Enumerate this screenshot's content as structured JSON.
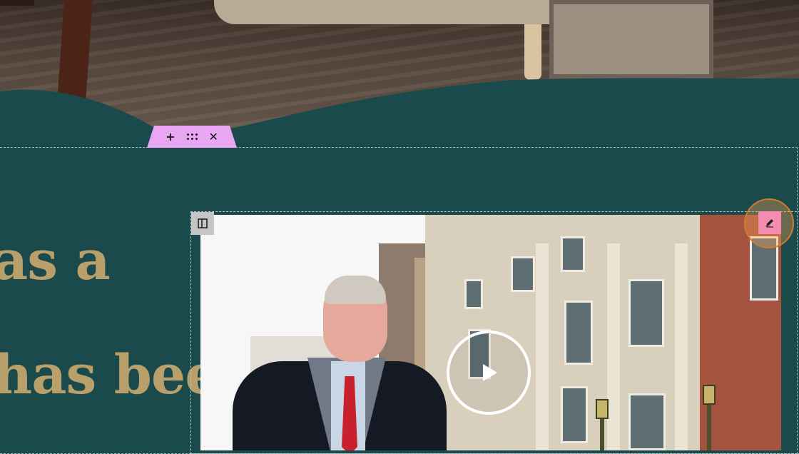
{
  "hero": {
    "background_image": "wooden-floor-with-chair-and-table-photo"
  },
  "block_toolbar": {
    "add_icon": "plus-icon",
    "drag_icon": "drag-handle-icon",
    "close_icon": "close-icon",
    "add_label": "+",
    "close_label": "✕",
    "accent_color": "#e9a7f3"
  },
  "section": {
    "background_color": "#1b4a4c",
    "heading_line_1": "as a",
    "heading_line_2": "has been",
    "heading_color": "#b9a06a"
  },
  "video_column": {
    "column_toggle_icon": "columns-icon",
    "edit_icon": "pencil-icon",
    "edit_accent_color": "#f48bb0",
    "play_icon": "play-icon",
    "thumbnail": "man-in-academic-gown-in-front-of-georgian-building"
  }
}
